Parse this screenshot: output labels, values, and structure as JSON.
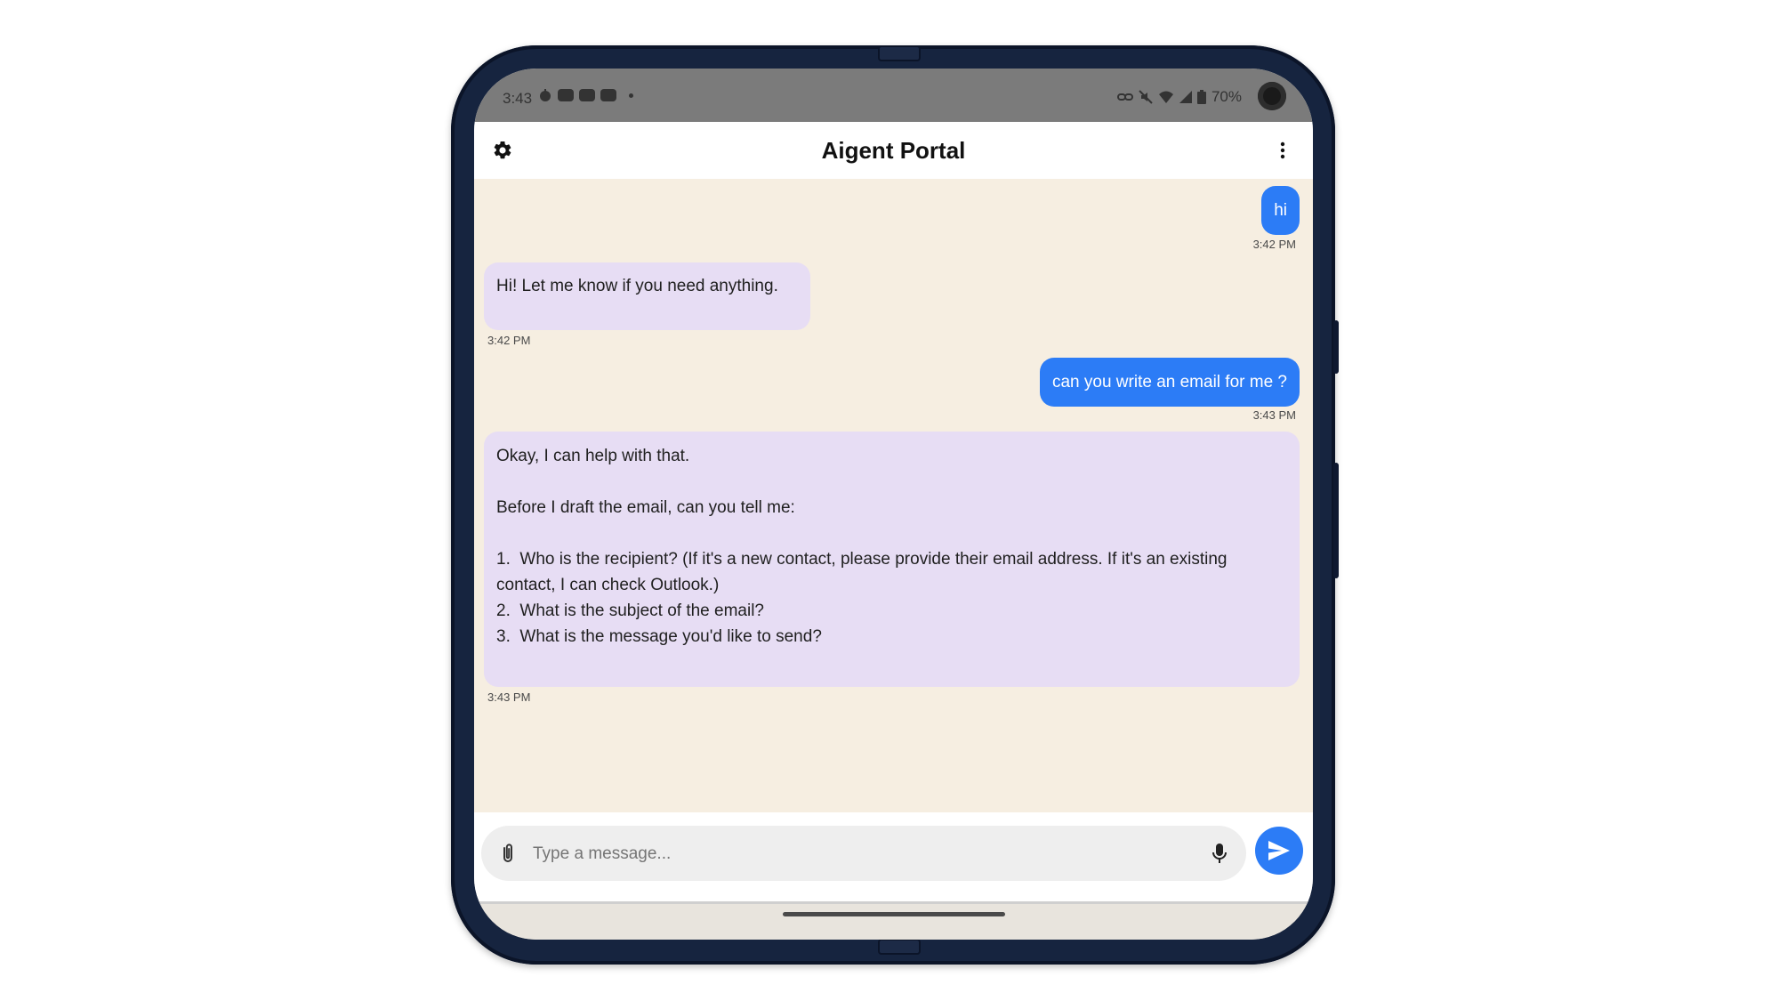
{
  "status_bar": {
    "time": "3:43",
    "battery": "70%"
  },
  "app_bar": {
    "title": "Aigent Portal",
    "settings_icon": "gear-icon",
    "menu_icon": "more-vert-icon"
  },
  "messages": [
    {
      "role": "user",
      "text": "hi",
      "time": "3:42 PM"
    },
    {
      "role": "bot",
      "text": "Hi! Let me know if you need anything.",
      "time": "3:42 PM"
    },
    {
      "role": "user",
      "text": "can you write an email for me ?",
      "time": "3:43 PM"
    },
    {
      "role": "bot",
      "lines": [
        "Okay, I can help with that.",
        "",
        "Before I draft the email, can you tell me:",
        "",
        "1.  Who is the recipient? (If it's a new contact, please provide their email address. If it's an existing contact, I can check Outlook.)",
        "2.  What is the subject of the email?",
        "3.  What is the message you'd like to send?"
      ],
      "time": "3:43 PM"
    }
  ],
  "composer": {
    "placeholder": "Type a message...",
    "attach_icon": "paperclip-icon",
    "mic_icon": "mic-icon",
    "send_icon": "send-icon"
  },
  "colors": {
    "user_bubble": "#2c7cf6",
    "bot_bubble": "#e7ddf4",
    "chat_background": "#f6eee1"
  }
}
